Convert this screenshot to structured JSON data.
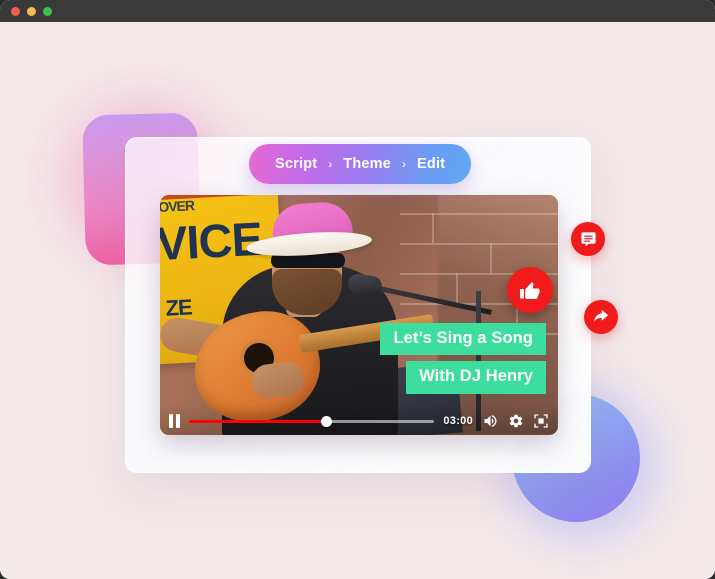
{
  "window": {
    "traffic_lights": [
      "close",
      "minimize",
      "maximize"
    ],
    "titlebar_color": "#3a3a3a",
    "background_color": "#f4eaea"
  },
  "breadcrumb": {
    "name": "script-theme-edit-breadcrumb",
    "separator": "›",
    "steps": [
      {
        "label": "Script"
      },
      {
        "label": "Theme"
      },
      {
        "label": "Edit"
      }
    ],
    "gradient_from": "#e66ad1",
    "gradient_to": "#61a8f5"
  },
  "player": {
    "time_label": "03:00",
    "progress_percent": 56,
    "state": "playing",
    "captions": [
      {
        "text": "Let’s Sing a Song"
      },
      {
        "text": "With DJ Henry"
      }
    ],
    "caption_color": "#3dde9d",
    "accent_color": "#ff0000",
    "controls": [
      {
        "name": "pause-button",
        "label": "Pause"
      },
      {
        "name": "volume-button",
        "label": "Volume"
      },
      {
        "name": "settings-button",
        "label": "Settings"
      },
      {
        "name": "fullscreen-button",
        "label": "Fullscreen"
      }
    ],
    "scene": {
      "sign_text_top": "OVER",
      "sign_text_main": "VICE",
      "sign_text_bottom": "ZE"
    }
  },
  "overlays": {
    "like_badge": {
      "name": "thumbs-up-badge",
      "color": "#f21b1b"
    }
  },
  "side_actions": [
    {
      "name": "comment-button",
      "icon": "comment-icon",
      "color": "#f21b1b"
    },
    {
      "name": "share-button",
      "icon": "share-icon",
      "color": "#f21b1b"
    }
  ],
  "decorations": {
    "pink_square": {
      "from": "#c79bf0",
      "to": "#ef5fa0"
    },
    "blue_circle": {
      "from": "#9fc5f6",
      "to": "#a57ff0"
    }
  }
}
